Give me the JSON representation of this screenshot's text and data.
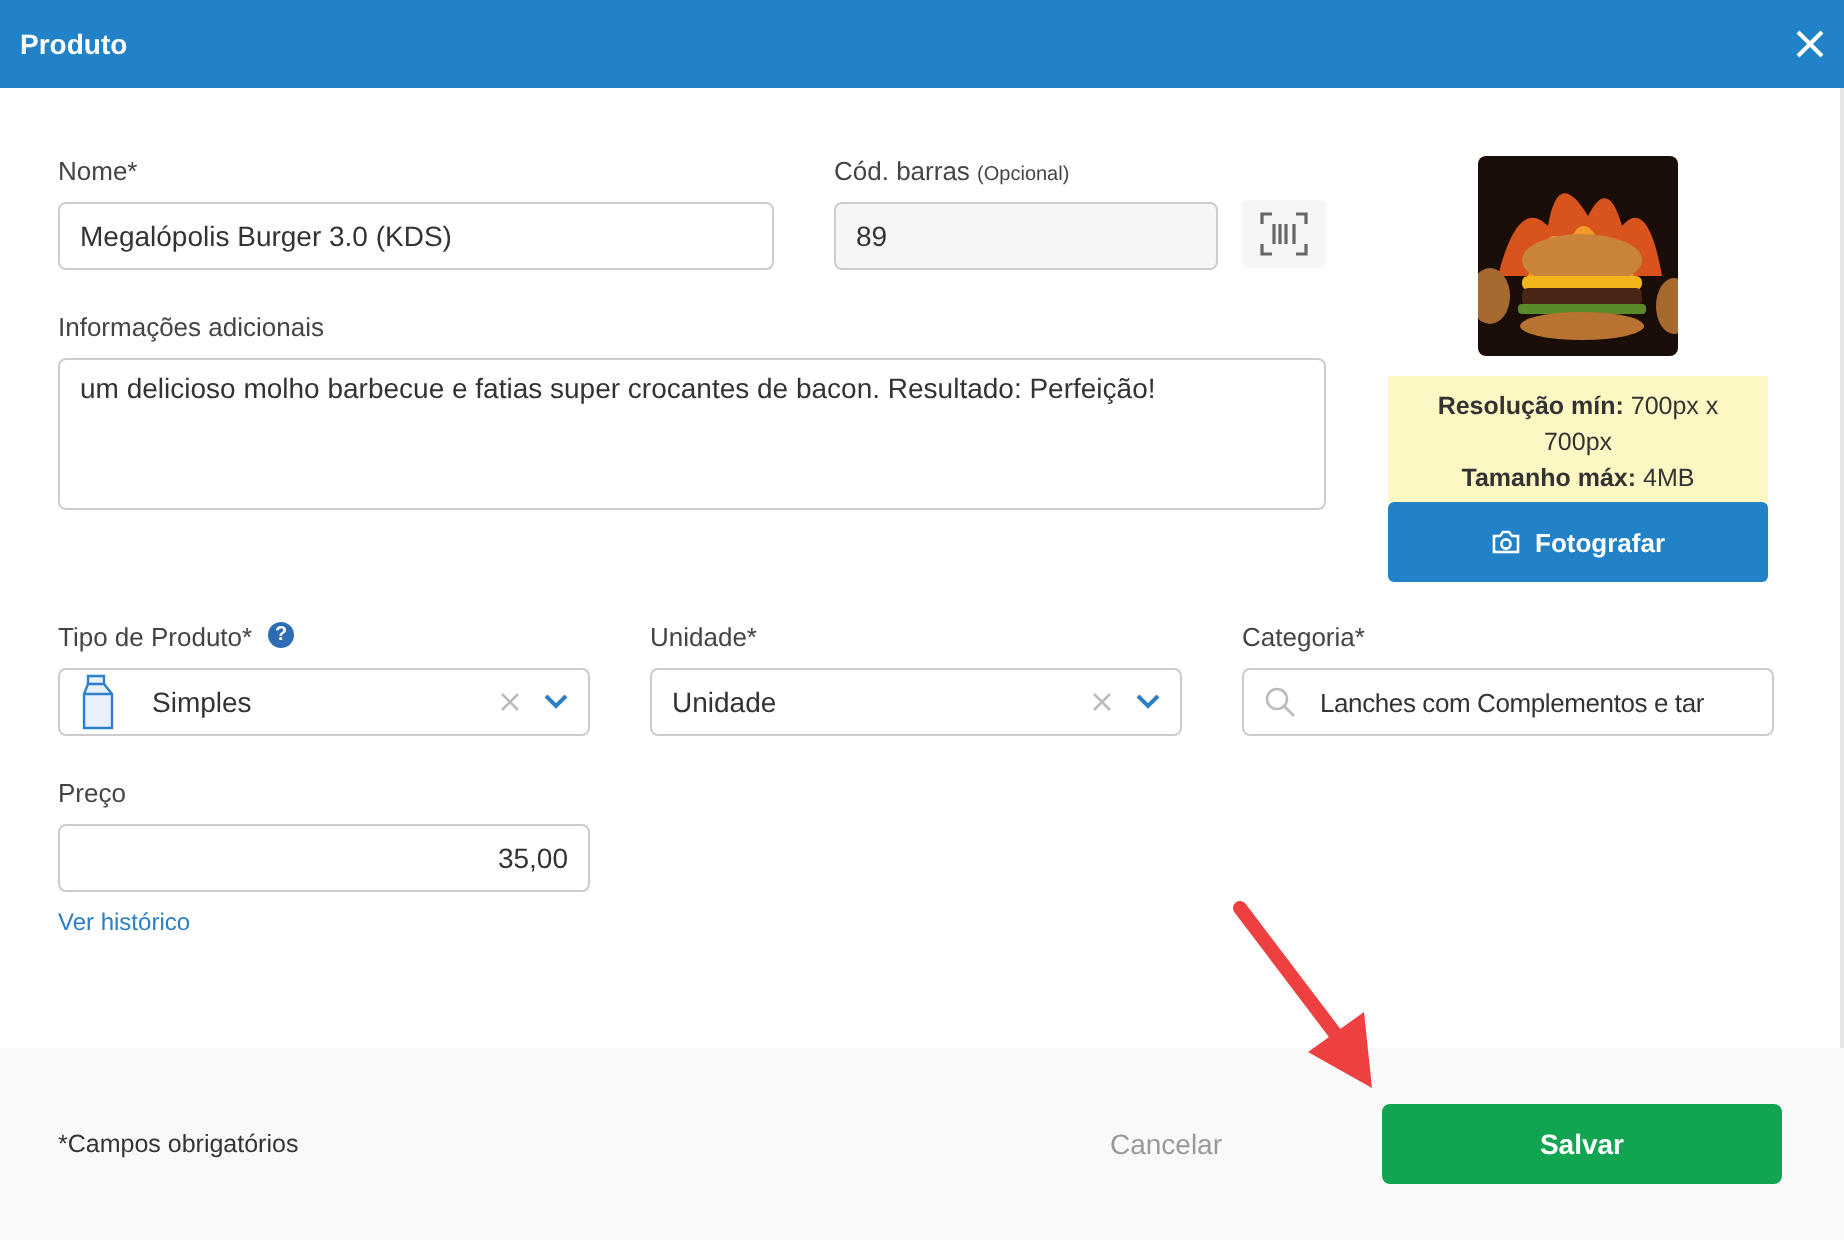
{
  "window": {
    "title": "Produto"
  },
  "name_field": {
    "label": "Nome*",
    "value": "Megalópolis Burger 3.0 (KDS)"
  },
  "barcode_field": {
    "label": "Cód. barras",
    "hint": "(Opcional)",
    "value": "89"
  },
  "info_field": {
    "label": "Informações adicionais",
    "value": "um delicioso molho barbecue e fatias super crocantes de bacon. Resultado: Perfeição!"
  },
  "image_panel": {
    "requirements": "**Resolução mín:** 700px x 700px",
    "max_size": "**Tamanho máx:** 4MB",
    "button": "Fotografar"
  },
  "product_type": {
    "label": "Tipo de Produto*",
    "help": "?",
    "value": "Simples"
  },
  "unit": {
    "label": "Unidade*",
    "value": "Unidade"
  },
  "category": {
    "label": "Categoria*",
    "value": "Lanches com Complementos e tar"
  },
  "price": {
    "label": "Preço",
    "value": "35,00",
    "link": "Ver histórico"
  },
  "footer": {
    "note": "*Campos obrigatórios",
    "cancel": "Cancelar",
    "save": "Salvar"
  }
}
